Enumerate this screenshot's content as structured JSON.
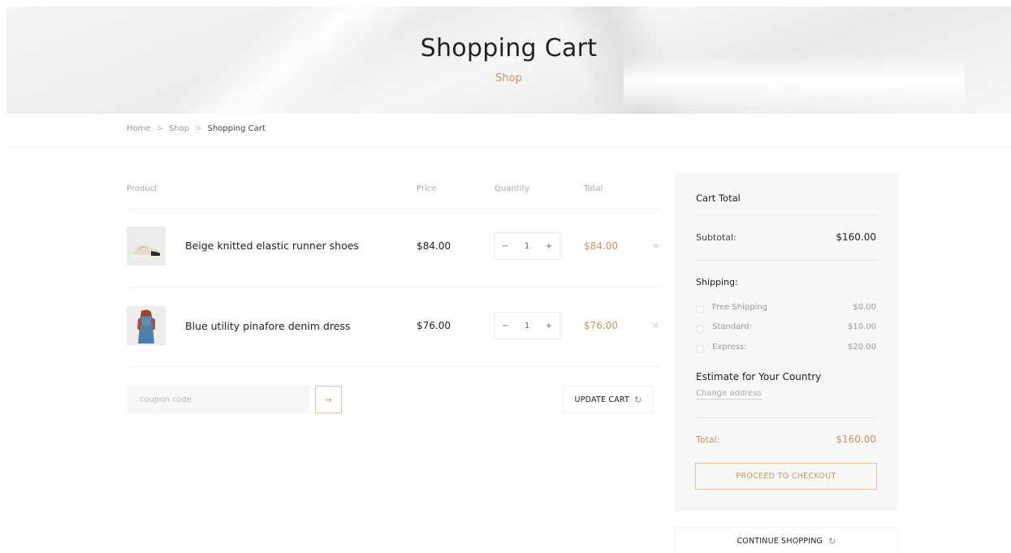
{
  "hero": {
    "title": "Shopping Cart",
    "subtitle": "Shop"
  },
  "breadcrumb": {
    "items": [
      "Home",
      "Shop",
      "Shopping Cart"
    ],
    "separator": ">"
  },
  "cart_table": {
    "headers": {
      "product": "Product",
      "price": "Price",
      "quantity": "Quantity",
      "total": "Total"
    },
    "rows": [
      {
        "name": "Beige knitted elastic runner shoes",
        "price": "$84.00",
        "quantity": "1",
        "total": "$84.00",
        "image_icon": "shoe-image"
      },
      {
        "name": "Blue utility pinafore denim dress",
        "price": "$76.00",
        "quantity": "1",
        "total": "$76.00",
        "image_icon": "dress-image"
      }
    ],
    "qty_minus": "−",
    "qty_plus": "+",
    "remove": "×"
  },
  "coupon": {
    "placeholder": "coupon code",
    "apply_icon": "→"
  },
  "update_cart": {
    "label": "UPDATE CART",
    "icon": "↻"
  },
  "cart_total": {
    "title": "Cart Total",
    "subtotal_label": "Subtotal:",
    "subtotal_value": "$160.00",
    "shipping_label": "Shipping:",
    "shipping_options": [
      {
        "name": "Free Shipping",
        "price": "$0.00"
      },
      {
        "name": "Standard:",
        "price": "$10.00"
      },
      {
        "name": "Express:",
        "price": "$20.00"
      }
    ],
    "estimate_label": "Estimate for Your Country",
    "change_address": "Change address",
    "total_label": "Total:",
    "total_value": "$160.00",
    "checkout_label": "PROCEED TO CHECKOUT"
  },
  "continue_shopping": {
    "label": "CONTINUE SHOPPING",
    "icon": "↻"
  },
  "colors": {
    "accent": "#c79561",
    "panel_bg": "#f7f7f7",
    "text": "#222222"
  }
}
